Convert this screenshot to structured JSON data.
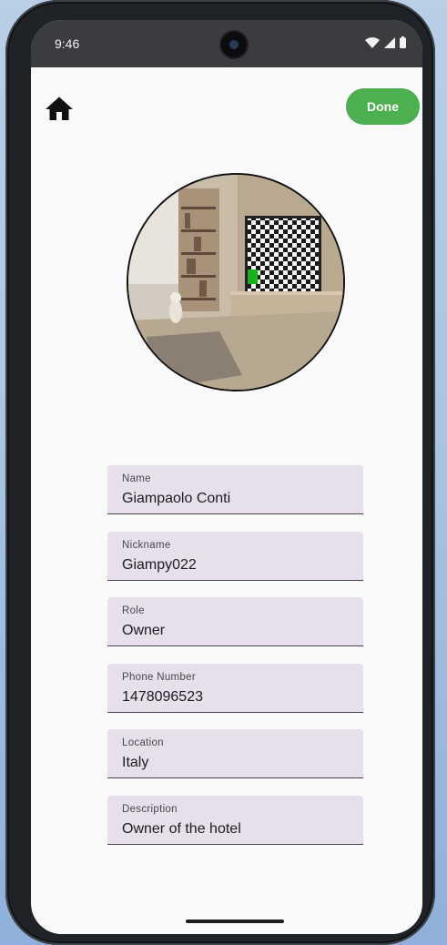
{
  "status_bar": {
    "time": "9:46",
    "icons": [
      "wifi-icon",
      "cell-signal-icon",
      "battery-icon"
    ]
  },
  "top_bar": {
    "home_icon": "home-icon",
    "done_label": "Done"
  },
  "profile": {
    "photo_description": "living-room-photo"
  },
  "fields": [
    {
      "label": "Name",
      "value": "Giampaolo Conti"
    },
    {
      "label": "Nickname",
      "value": "Giampy022"
    },
    {
      "label": "Role",
      "value": "Owner"
    },
    {
      "label": "Phone Number",
      "value": "1478096523"
    },
    {
      "label": "Location",
      "value": "Italy"
    },
    {
      "label": "Description",
      "value": "Owner of the hotel"
    }
  ],
  "colors": {
    "done_button": "#4caf50",
    "field_bg": "#e7dfec",
    "screen_bg": "#fafafa"
  }
}
